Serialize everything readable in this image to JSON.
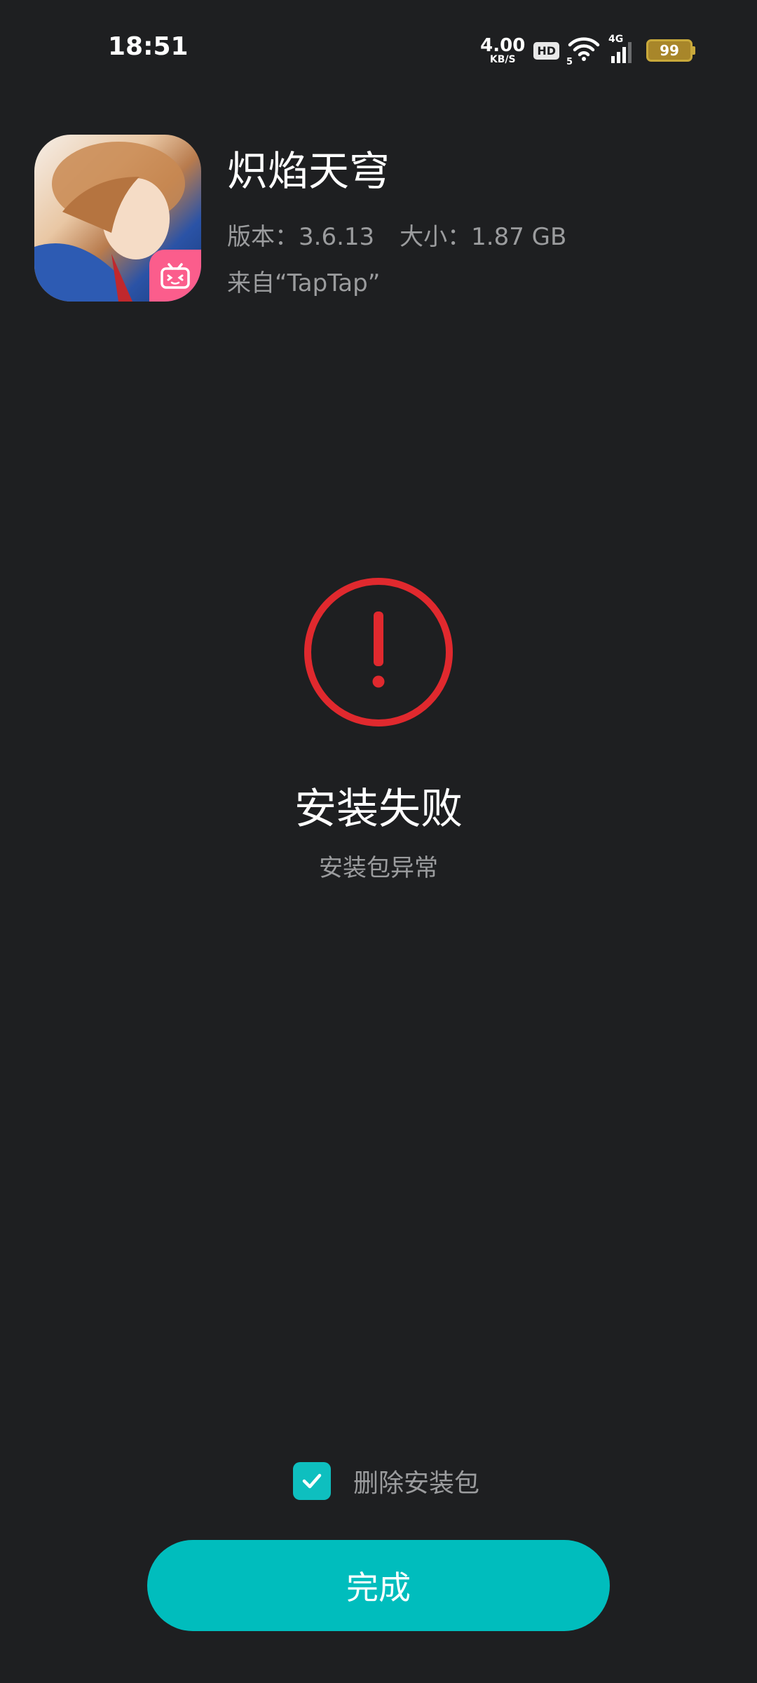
{
  "status_bar": {
    "time": "18:51",
    "net_speed_value": "4.00",
    "net_speed_unit": "KB/S",
    "hd_label": "HD",
    "wifi_sub": "5",
    "cell_label": "4G",
    "battery_level": "99",
    "battery_color": "#c9a93b"
  },
  "app": {
    "name": "炽焰天穹",
    "version_text": "版本：3.6.13",
    "size_text": "大小：1.87 GB",
    "source_text": "来自“TapTap”",
    "icon": "game-app-icon",
    "badge_icon": "bilibili-tv-icon",
    "badge_color": "#fb5d8c"
  },
  "result": {
    "icon": "error-exclamation-icon",
    "icon_color": "#e0292e",
    "title": "安装失败",
    "subtitle": "安装包异常"
  },
  "options": {
    "delete_package_label": "删除安装包",
    "delete_package_checked": true,
    "checkbox_color": "#0ebfbf"
  },
  "actions": {
    "done_label": "完成",
    "done_color": "#00bdbd"
  }
}
